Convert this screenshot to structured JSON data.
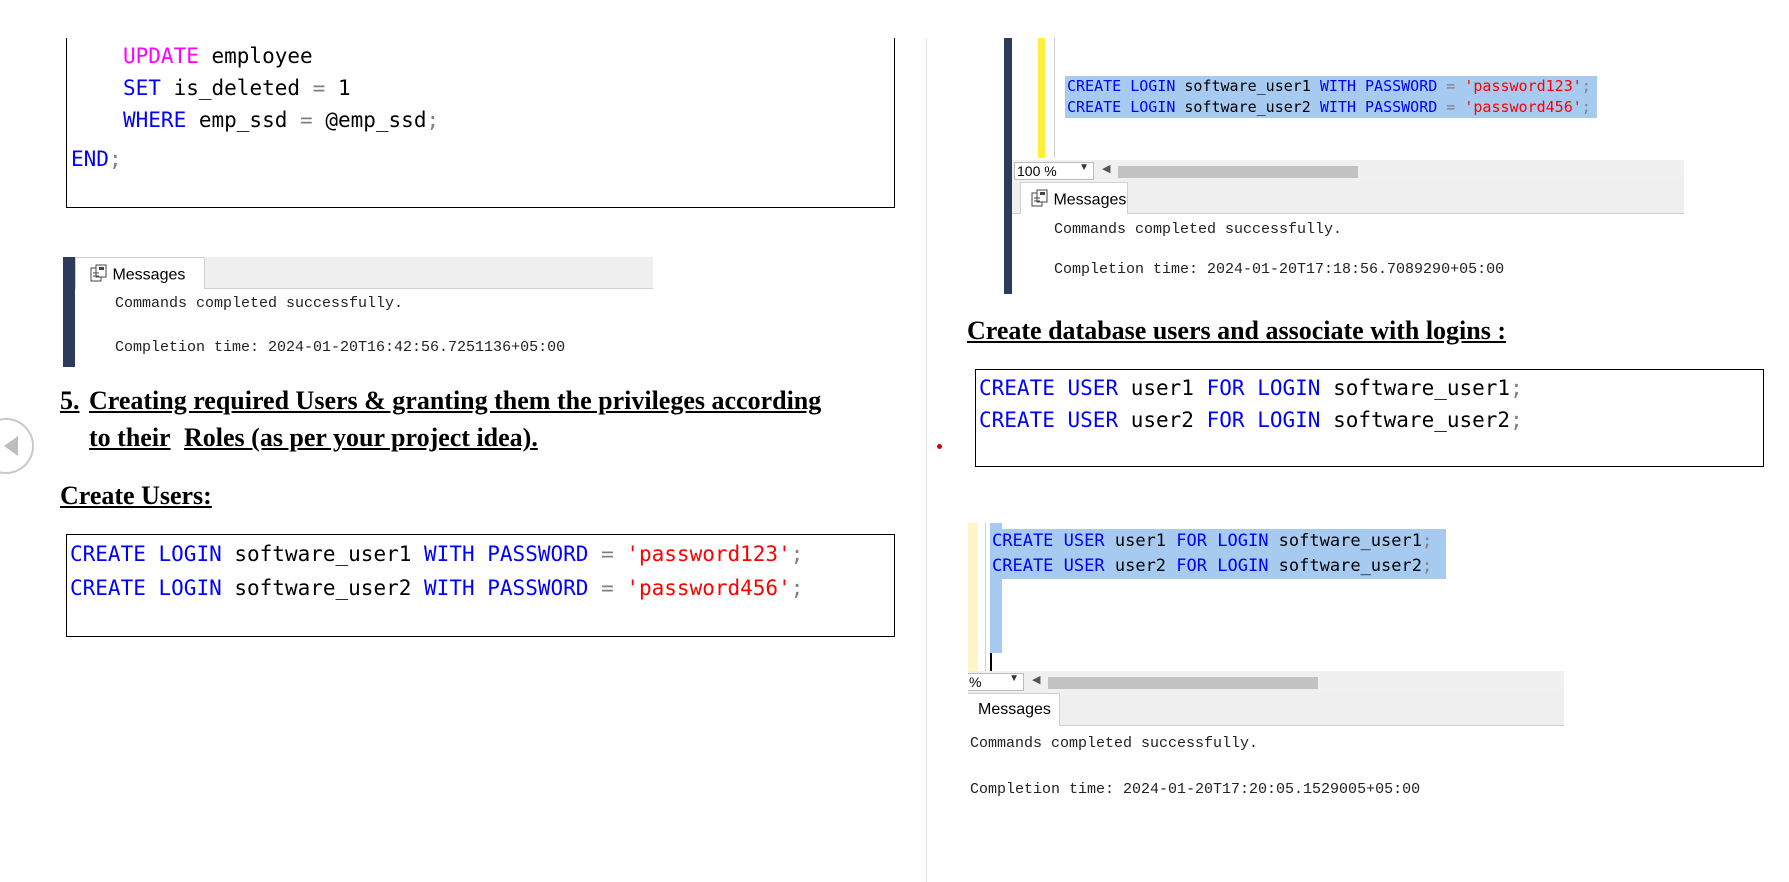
{
  "left": {
    "top_code": {
      "lines": [
        [
          {
            "t": "UPDATE",
            "c": "kwm"
          },
          {
            "t": " employee",
            "c": "txt"
          }
        ],
        [
          {
            "t": "SET",
            "c": "kw"
          },
          {
            "t": " is_deleted ",
            "c": "txt"
          },
          {
            "t": "=",
            "c": "punc"
          },
          {
            "t": " 1",
            "c": "txt"
          }
        ],
        [
          {
            "t": "WHERE",
            "c": "kw"
          },
          {
            "t": " emp_ssd ",
            "c": "txt"
          },
          {
            "t": "=",
            "c": "punc"
          },
          {
            "t": " @emp_ssd",
            "c": "txt"
          },
          {
            "t": ";",
            "c": "punc"
          }
        ]
      ],
      "end_line": [
        {
          "t": "END",
          "c": "kw"
        },
        {
          "t": ";",
          "c": "punc"
        }
      ]
    },
    "messages1": {
      "tab_label": "Messages",
      "line1": "Commands completed successfully.",
      "line2": "Completion time: 2024-01-20T16:42:56.7251136+05:00"
    },
    "section_number": "5.",
    "section_title_line1": "Creating required Users & granting them the privileges according",
    "section_title_line2a": "to their",
    "section_title_line2b": "Roles (as per your project idea).",
    "create_users_heading": "Create Users:",
    "login_code": {
      "lines": [
        [
          {
            "t": "CREATE",
            "c": "kw"
          },
          {
            "t": " ",
            "c": "txt"
          },
          {
            "t": "LOGIN",
            "c": "kw"
          },
          {
            "t": " software_user1 ",
            "c": "txt"
          },
          {
            "t": "WITH",
            "c": "kw"
          },
          {
            "t": " ",
            "c": "txt"
          },
          {
            "t": "PASSWORD",
            "c": "kw"
          },
          {
            "t": " = ",
            "c": "punc"
          },
          {
            "t": "'password123'",
            "c": "str"
          },
          {
            "t": ";",
            "c": "punc"
          }
        ],
        [
          {
            "t": "CREATE",
            "c": "kw"
          },
          {
            "t": " ",
            "c": "txt"
          },
          {
            "t": "LOGIN",
            "c": "kw"
          },
          {
            "t": " software_user2 ",
            "c": "txt"
          },
          {
            "t": "WITH",
            "c": "kw"
          },
          {
            "t": " ",
            "c": "txt"
          },
          {
            "t": "PASSWORD",
            "c": "kw"
          },
          {
            "t": " = ",
            "c": "punc"
          },
          {
            "t": "'password456'",
            "c": "str"
          },
          {
            "t": ";",
            "c": "punc"
          }
        ]
      ]
    }
  },
  "right": {
    "ssms1": {
      "lines": [
        [
          {
            "t": "CREATE",
            "c": "kw"
          },
          {
            "t": " ",
            "c": "txt"
          },
          {
            "t": "LOGIN",
            "c": "kw"
          },
          {
            "t": " software_user1 ",
            "c": "txt"
          },
          {
            "t": "WITH",
            "c": "kw"
          },
          {
            "t": " ",
            "c": "txt"
          },
          {
            "t": "PASSWORD",
            "c": "kw"
          },
          {
            "t": " = ",
            "c": "punc"
          },
          {
            "t": "'password123'",
            "c": "str"
          },
          {
            "t": ";",
            "c": "punc"
          }
        ],
        [
          {
            "t": "CREATE",
            "c": "kw"
          },
          {
            "t": " ",
            "c": "txt"
          },
          {
            "t": "LOGIN",
            "c": "kw"
          },
          {
            "t": " software_user2 ",
            "c": "txt"
          },
          {
            "t": "WITH",
            "c": "kw"
          },
          {
            "t": " ",
            "c": "txt"
          },
          {
            "t": "PASSWORD",
            "c": "kw"
          },
          {
            "t": " = ",
            "c": "punc"
          },
          {
            "t": "'password456'",
            "c": "str"
          },
          {
            "t": ";",
            "c": "punc"
          }
        ]
      ],
      "zoom": "100 %",
      "tab_label": "Messages",
      "line1": "Commands completed successfully.",
      "line2": "Completion time: 2024-01-20T17:18:56.7089290+05:00"
    },
    "db_users_heading": "Create database users and associate with logins :",
    "user_code": {
      "lines": [
        [
          {
            "t": "CREATE",
            "c": "kw"
          },
          {
            "t": " ",
            "c": "txt"
          },
          {
            "t": "USER",
            "c": "kw"
          },
          {
            "t": " user1 ",
            "c": "txt"
          },
          {
            "t": "FOR",
            "c": "kw"
          },
          {
            "t": " ",
            "c": "txt"
          },
          {
            "t": "LOGIN",
            "c": "kw"
          },
          {
            "t": " software_user1",
            "c": "txt"
          },
          {
            "t": ";",
            "c": "punc"
          }
        ],
        [
          {
            "t": "CREATE",
            "c": "kw"
          },
          {
            "t": " ",
            "c": "txt"
          },
          {
            "t": "USER",
            "c": "kw"
          },
          {
            "t": " user2 ",
            "c": "txt"
          },
          {
            "t": "FOR",
            "c": "kw"
          },
          {
            "t": " ",
            "c": "txt"
          },
          {
            "t": "LOGIN",
            "c": "kw"
          },
          {
            "t": " software_user2",
            "c": "txt"
          },
          {
            "t": ";",
            "c": "punc"
          }
        ]
      ]
    },
    "ssms2": {
      "lines": [
        [
          {
            "t": "CREATE",
            "c": "kw"
          },
          {
            "t": " ",
            "c": "txt"
          },
          {
            "t": "USER",
            "c": "kw"
          },
          {
            "t": " user1 ",
            "c": "txt"
          },
          {
            "t": "FOR",
            "c": "kw"
          },
          {
            "t": " ",
            "c": "txt"
          },
          {
            "t": "LOGIN",
            "c": "kw"
          },
          {
            "t": " software_user1",
            "c": "txt"
          },
          {
            "t": ";",
            "c": "punc"
          }
        ],
        [
          {
            "t": "CREATE",
            "c": "kw"
          },
          {
            "t": " ",
            "c": "txt"
          },
          {
            "t": "USER",
            "c": "kw"
          },
          {
            "t": " user2 ",
            "c": "txt"
          },
          {
            "t": "FOR",
            "c": "kw"
          },
          {
            "t": " ",
            "c": "txt"
          },
          {
            "t": "LOGIN",
            "c": "kw"
          },
          {
            "t": " software_user2",
            "c": "txt"
          },
          {
            "t": ";",
            "c": "punc"
          }
        ]
      ],
      "zoom": "%",
      "tab_label": "Messages",
      "line1": "Commands completed successfully.",
      "line2": "Completion time: 2024-01-20T17:20:05.1529005+05:00"
    }
  },
  "nav": {
    "prev_icon": "chevron-left-icon"
  },
  "colors": {
    "keyword": "#0000ff",
    "update_keyword": "#ff00ff",
    "string": "#ff0000",
    "selection": "#a6caf0"
  }
}
